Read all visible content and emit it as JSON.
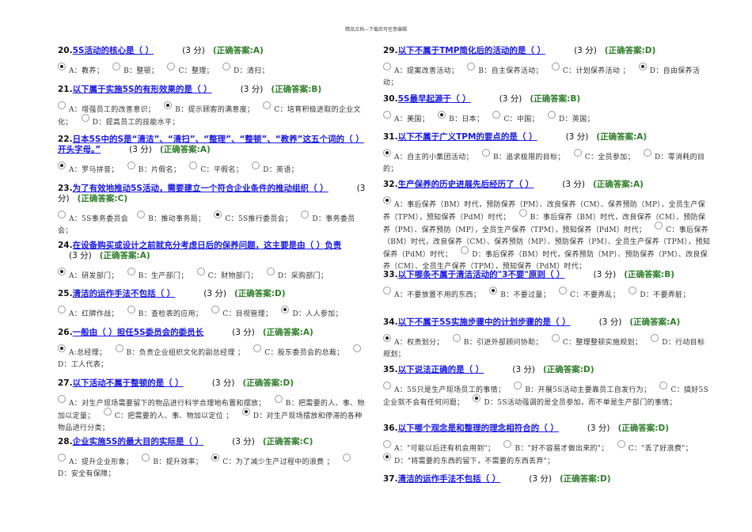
{
  "header": "精品文档---下载后可任意编辑",
  "questions": [
    {
      "num": "20.",
      "text": "5S活动的核心是（ ）",
      "score": "(3 分)",
      "answer": "(正确答案:A)",
      "options": [
        {
          "text": "A：教养；",
          "selected": true
        },
        {
          "text": "B：整顿；",
          "selected": false
        },
        {
          "text": "C：整理；",
          "selected": false
        },
        {
          "text": "D：清扫；",
          "selected": false
        }
      ]
    },
    {
      "num": "21.",
      "text": "以下属于实施5S的有形效果的是（ ）",
      "score": "(3 分)",
      "answer": "(正确答案:B)",
      "options": [
        {
          "text": "A：增强员工的改善意识；",
          "selected": false
        },
        {
          "text": "B：提示顾客的满意度；",
          "selected": true
        },
        {
          "text": "C：培育积极进取的企业文化；",
          "selected": false
        },
        {
          "text": "D：提高员工的技能水平；",
          "selected": false
        }
      ]
    },
    {
      "num": "22.",
      "text": "日本5S中的S是“清洁”、“清扫”、“整理”、“整顿”、“教养”这五个词的（ ）开头字母。”",
      "score": "(3 分)",
      "answer": "(正确答案:A)",
      "options": [
        {
          "text": "A：罗马拼音；",
          "selected": true
        },
        {
          "text": "B：片假名；",
          "selected": false
        },
        {
          "text": "C：平假名；",
          "selected": false
        },
        {
          "text": "D：英语；",
          "selected": false
        }
      ]
    },
    {
      "num": "23.",
      "text": "为了有效地推动5S活动，需要建立一个符合企业条件的推动组织（ ）",
      "score": "(3 分)",
      "answer": "(正确答案:C)",
      "options": [
        {
          "text": "A：5S事务委员会",
          "selected": false
        },
        {
          "text": "B：推动事务局；",
          "selected": false
        },
        {
          "text": "C：5S推行委员会；",
          "selected": true
        },
        {
          "text": "D：事务委员会；",
          "selected": false
        }
      ]
    },
    {
      "num": "24.",
      "text": "在设备购买或设计之前就充分考虑日后的保养问题，这主要是由（ ）负责",
      "score": "(3 分)",
      "answer": "(正确答案:A)",
      "options": [
        {
          "text": "A：研发部门；",
          "selected": true
        },
        {
          "text": "B：生产部门；",
          "selected": false
        },
        {
          "text": "C：财物部门；",
          "selected": false
        },
        {
          "text": "D：采购部门；",
          "selected": false
        }
      ]
    },
    {
      "num": "25.",
      "text": "清洁的运作手法不包括（ ）",
      "score": "(3 分)",
      "answer": "(正确答案:D)",
      "options": [
        {
          "text": "A：红牌作战；",
          "selected": false
        },
        {
          "text": "B：查检表的应用；",
          "selected": false
        },
        {
          "text": "C：目视管理；",
          "selected": false
        },
        {
          "text": "D：人人参加；",
          "selected": true
        }
      ]
    },
    {
      "num": "26.",
      "text": "一般由（ ）担任5S委员会的委员长",
      "score": "(3 分)",
      "answer": "(正确答案:A)",
      "options": [
        {
          "text": "A:总经理；",
          "selected": true
        },
        {
          "text": "B：负责企业组织文化的副总经理 ；",
          "selected": false
        },
        {
          "text": "C：股东委员会的总裁；",
          "selected": false
        },
        {
          "text": "D：工人代表；",
          "selected": false
        }
      ]
    },
    {
      "num": "27.",
      "text": "以下活动不属于整顿的是（ ）",
      "score": "(3 分)",
      "answer": "(正确答案:D)",
      "options": [
        {
          "text": "A：对生产现场需要留下的物品进行科学合理地布置和摆放；",
          "selected": false
        },
        {
          "text": "B：把需要的人、事、物加以定量；",
          "selected": false
        },
        {
          "text": "C：把需要的人、事、物加以定位 ；",
          "selected": false
        },
        {
          "text": "D：对生产现场摆放和停滞的各种物品进行分类；",
          "selected": true
        }
      ]
    },
    {
      "num": "28.",
      "text": "企业实施5S的最大目的实际是（ ）",
      "score": "(3 分)",
      "answer": "(正确答案:C)",
      "options": [
        {
          "text": "A：提升企业形象；",
          "selected": false
        },
        {
          "text": "B：提升效率；",
          "selected": false
        },
        {
          "text": "C：为了减少生产过程中的浪费 ；",
          "selected": true
        },
        {
          "text": "D：安全有保障；",
          "selected": false
        }
      ]
    },
    {
      "num": "29.",
      "text": "以下不属于TMP简化后的活动的是（ ）",
      "score": "(3 分)",
      "answer": "(正确答案:D)",
      "options": [
        {
          "text": "A：提案改善活动；",
          "selected": false
        },
        {
          "text": "B：自主保养活动；",
          "selected": false
        },
        {
          "text": "C：计划保养活动 ；",
          "selected": false
        },
        {
          "text": "D：自由保养活动；",
          "selected": true
        }
      ]
    },
    {
      "num": "30.",
      "text": "5S最早起源于（ ）",
      "score": "(3 分)",
      "answer": "(正确答案:B)",
      "options": [
        {
          "text": "A：美国；",
          "selected": false
        },
        {
          "text": "B：日本；",
          "selected": true
        },
        {
          "text": "C：中国；",
          "selected": false
        },
        {
          "text": "D：英国；",
          "selected": false
        }
      ]
    },
    {
      "num": "31.",
      "text": "以下不属于广义TPM的要点的是（ ）",
      "score": "(3 分)",
      "answer": "(正确答案:A)",
      "options": [
        {
          "text": "A：自主的小集团活动；",
          "selected": true
        },
        {
          "text": "B：追求极限的目标；",
          "selected": false
        },
        {
          "text": "C：全员参加；",
          "selected": false
        },
        {
          "text": "D：零消耗的目的；",
          "selected": false
        }
      ]
    },
    {
      "num": "32.",
      "text": "生产保养的历史进展先后经历了（ ）",
      "score": "(3 分)",
      "answer": "(正确答案:A)",
      "options": [
        {
          "text": "A：事后保养（BM）时代，预防保养（PM）、改良保养（CM）、保养预防（MP），全员生产保养（TPM），预知保养（PdM）时代；",
          "selected": true
        },
        {
          "text": "B：事后保养（BM）时代，改良保养（CM）、预防保养（PM）、保养预防（MP），全员生产保养（TPM），预知保养（PdM）时代；",
          "selected": false
        },
        {
          "text": "C：事后保养（BM）时代，改良保养（CM）、保养预防（MP）、预防保养（PM）、全员生产保养（TPM），预知保养（PdM）时代；",
          "selected": false
        },
        {
          "text": "D：事后保养（BM）时代，保养预防（MP）、预防保养（PM）、改良保养（CM）、全员生产保养（TPM），预知保养（PdM）时代；",
          "selected": false
        }
      ]
    },
    {
      "num": "33.",
      "text": "以下哪条不属于清洁活动的\"3不要\"原则（ ）",
      "score": "(3 分)",
      "answer": "(正确答案:B)",
      "options": [
        {
          "text": "A：不要放置不用的东西；",
          "selected": false
        },
        {
          "text": "B：不要过量；",
          "selected": true
        },
        {
          "text": "C：不要弄乱；",
          "selected": false
        },
        {
          "text": "D：不要弄脏；",
          "selected": false
        }
      ]
    },
    {
      "num": "34.",
      "text": "以下不属于5S实施步骤中的计划步骤的是（ ）",
      "score": "(3 分)",
      "answer": "(正确答案:A)",
      "options": [
        {
          "text": "A：权责划分；",
          "selected": true
        },
        {
          "text": "B：引进外部顾问协助；",
          "selected": false
        },
        {
          "text": "C：整理整顿实施规划；",
          "selected": false
        },
        {
          "text": "D：行动目标规划；",
          "selected": false
        }
      ]
    },
    {
      "num": "35.",
      "text": "以下说法正确的是（ ）",
      "score": "(3 分)",
      "answer": "(正确答案:D)",
      "options": [
        {
          "text": "A：5S只是生产现场员工的事情；",
          "selected": false
        },
        {
          "text": "B：开展5S活动主要靠员工自发行为；",
          "selected": false
        },
        {
          "text": "C：搞好5S企业就不会有任何问题；",
          "selected": false
        },
        {
          "text": "D：5S活动强调的是全员参加，而不单是生产部门的事情；",
          "selected": true
        }
      ]
    },
    {
      "num": "36.",
      "text": "以下哪个观念是和整理的理念相符合的（ ）",
      "score": "(3 分)",
      "answer": "(正确答案:D)",
      "options": [
        {
          "text": "A：\"可能以后还有机会用到\"；",
          "selected": false
        },
        {
          "text": "B：\"好不容易才做出来的\"；",
          "selected": false
        },
        {
          "text": "C：\"丢了好浪费\"；",
          "selected": false
        },
        {
          "text": "D：\"将需要的东西的留下，不需要的东西丢弃\"；",
          "selected": true
        }
      ]
    },
    {
      "num": "37.",
      "text": "清洁的运作手法不包括（ ）",
      "score": "(3 分)",
      "answer": "(正确答案:D)",
      "options": []
    }
  ]
}
